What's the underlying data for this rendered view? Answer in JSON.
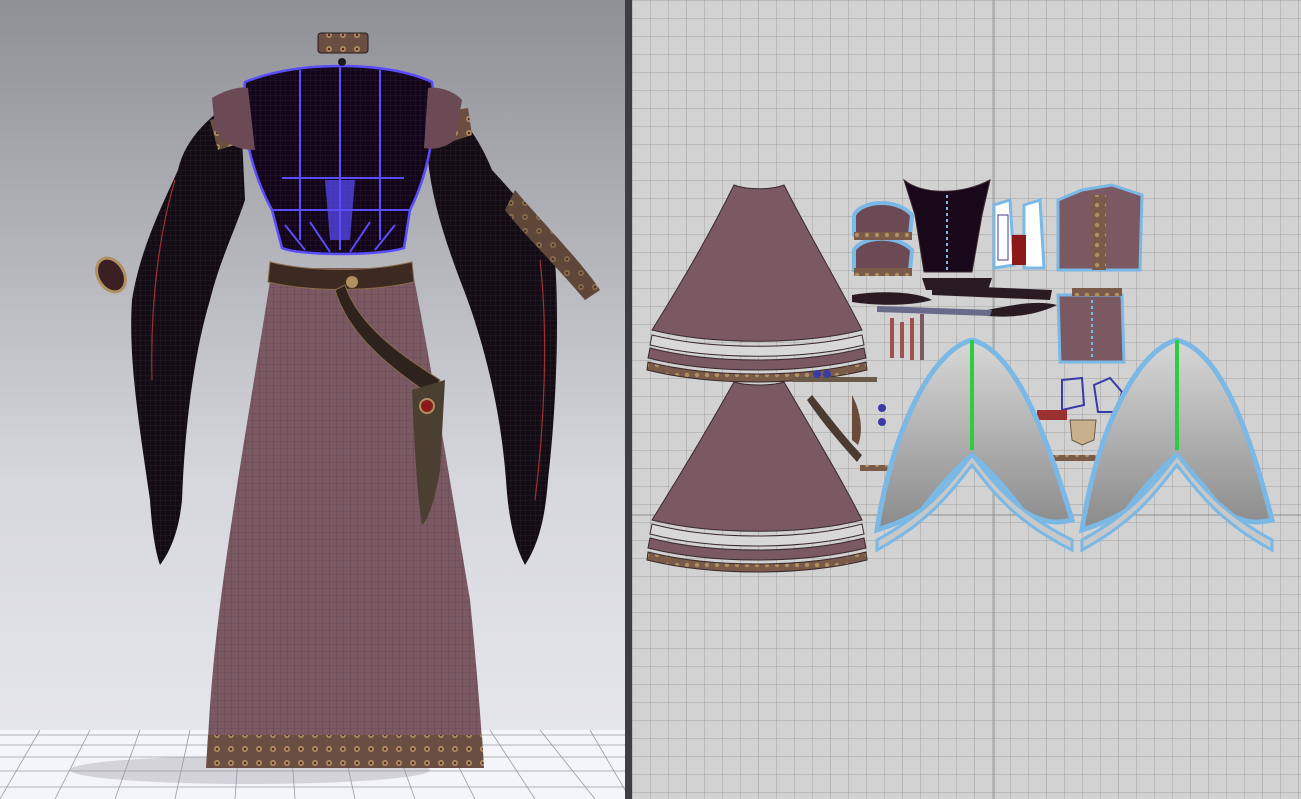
{
  "app": {
    "layout": "split-view",
    "left_panel": "3d-garment-viewport",
    "right_panel": "2d-pattern-window"
  },
  "colors": {
    "background_3d_top": "#8f9096",
    "background_3d_bottom": "#e9eaef",
    "background_2d": "#d2d2d2",
    "fabric_dress": "#7a5963",
    "fabric_dark": "#150a14",
    "selection_outline": "#5a4dff",
    "pattern_selection": "#7ab8e6",
    "sewing_line": "#2ecc40",
    "trim_gold": "#a88a5a"
  },
  "icons": [
    "grid-floor",
    "avatar-less-garment",
    "pattern-pieces"
  ]
}
